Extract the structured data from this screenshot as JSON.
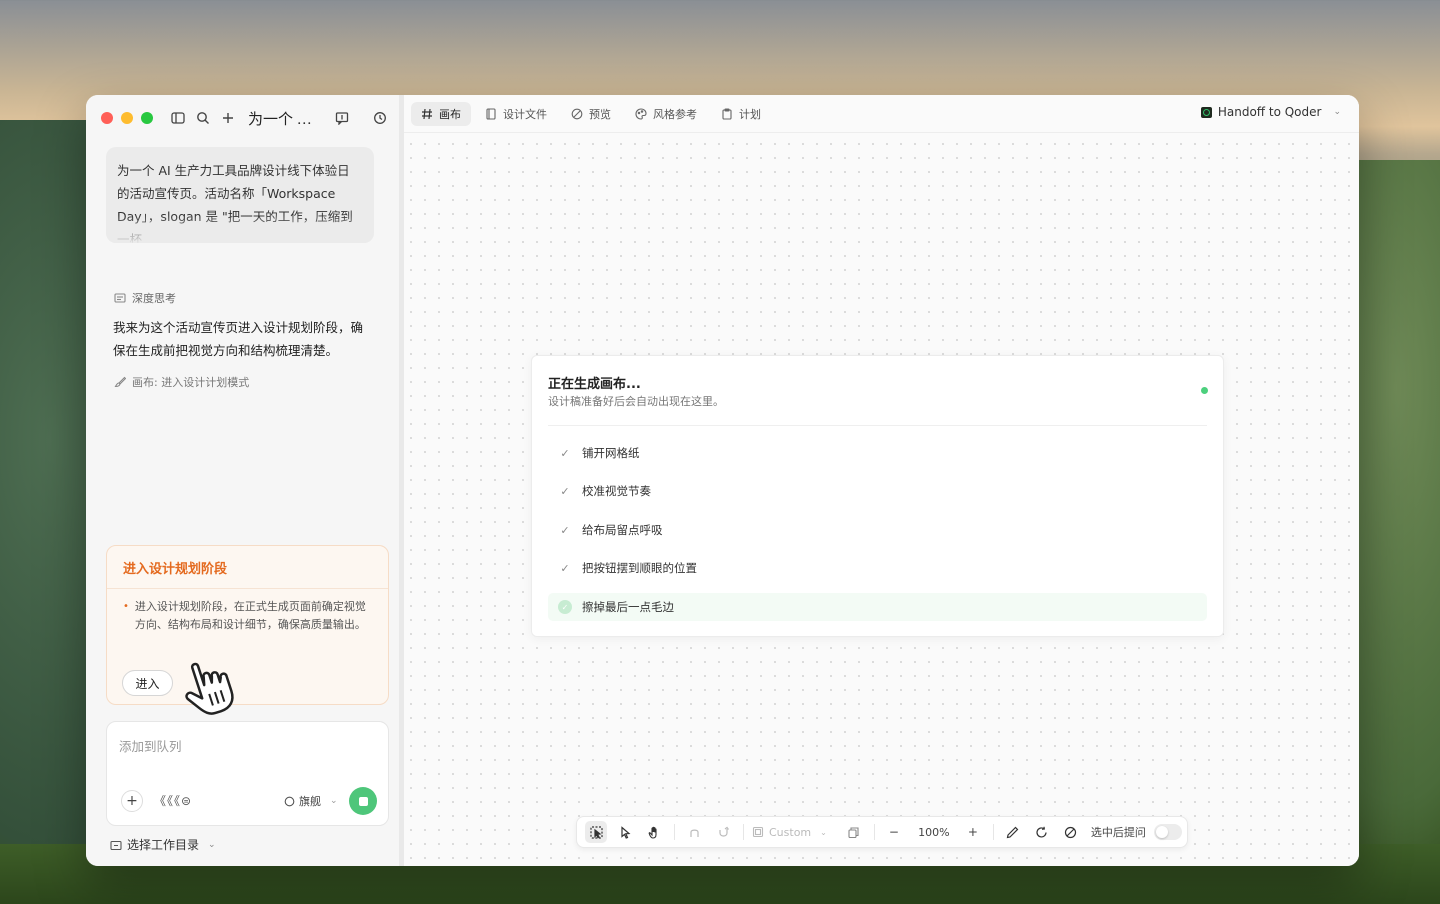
{
  "window": {
    "conversation_title": "为一个 AI 生..."
  },
  "sidebar": {
    "user_message": "为一个 AI 生产力工具品牌设计线下体验日的活动宣传页。活动名称「Workspace Day」，slogan 是 \"把一天的工作，压缩到一杯",
    "thinking_label": "深度思考",
    "assistant_text": "我来为这个活动宣传页进入设计规划阶段，确保在生成前把视觉方向和结构梳理清楚。",
    "tool_call": "画布: 进入设计计划模式",
    "plan_card": {
      "title": "进入设计规划阶段",
      "description": "进入设计规划阶段，在正式生成页面前确定视觉方向、结构布局和设计细节，确保高质量输出。",
      "enter_label": "进入"
    },
    "composer": {
      "placeholder": "添加到队列",
      "tool_icons_text": "《《《⊜",
      "model_label": "旗舰"
    },
    "workdir_label": "选择工作目录"
  },
  "tabs": [
    {
      "label": "画布",
      "icon": "hash-icon"
    },
    {
      "label": "设计文件",
      "icon": "file-icon"
    },
    {
      "label": "预览",
      "icon": "eye-icon"
    },
    {
      "label": "风格参考",
      "icon": "palette-icon"
    },
    {
      "label": "计划",
      "icon": "clipboard-icon"
    }
  ],
  "handoff_label": "Handoff to Qoder",
  "generation": {
    "title": "正在生成画布...",
    "subtitle": "设计稿准备好后会自动出现在这里。",
    "steps": [
      {
        "label": "铺开网格纸",
        "status": "done"
      },
      {
        "label": "校准视觉节奏",
        "status": "done"
      },
      {
        "label": "给布局留点呼吸",
        "status": "done"
      },
      {
        "label": "把按钮摆到顺眼的位置",
        "status": "done"
      },
      {
        "label": "擦掉最后一点毛边",
        "status": "in-progress"
      }
    ],
    "status_color": "#4cd07d"
  },
  "canvas_toolbar": {
    "custom_label": "Custom",
    "zoom_level": "100%",
    "select_ask_label": "选中后提问",
    "select_ask_enabled": false
  },
  "colors": {
    "accent_orange": "#e46a1f",
    "send_green": "#4ec67a"
  }
}
